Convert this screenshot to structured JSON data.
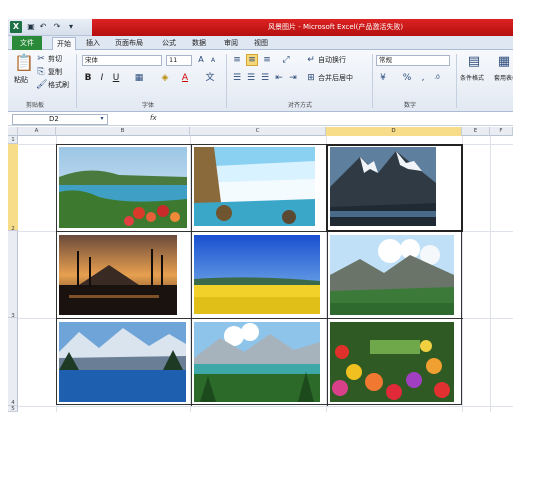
{
  "window": {
    "title": "风景图片 - Microsoft Excel(产品激活失败)"
  },
  "quick_access": {
    "app_icon": "excel-logo",
    "save_icon": "save-icon",
    "undo_icon": "undo-icon",
    "redo_icon": "redo-icon"
  },
  "ribbon_tabs": [
    "文件",
    "开始",
    "插入",
    "页面布局",
    "公式",
    "数据",
    "审阅",
    "视图"
  ],
  "ribbon": {
    "clipboard": {
      "paste": "粘贴",
      "cut": "剪切",
      "copy": "复制",
      "format_painter": "格式刷",
      "group_label": "剪贴板"
    },
    "font": {
      "font_name": "宋体",
      "font_size": "11",
      "bold": "B",
      "italic": "I",
      "underline": "U",
      "group_label": "字体"
    },
    "alignment": {
      "wrap_text": "自动换行",
      "merge_center": "合并后居中",
      "group_label": "对齐方式"
    },
    "number": {
      "format": "常规",
      "percent": "%",
      "comma": ",",
      "group_label": "数字"
    },
    "styles": {
      "conditional_format": "条件格式",
      "table_format": "套用表格格式"
    }
  },
  "formula_bar": {
    "name_box": "D2",
    "fx_label": "fx",
    "content": ""
  },
  "columns": [
    "A",
    "B",
    "C",
    "D",
    "E",
    "F"
  ],
  "selected_column": "D",
  "rows": [
    "1",
    "2",
    "3",
    "4",
    "5"
  ],
  "selected_row": "2",
  "photos": [
    {
      "name": "coastal-lake-with-flowers"
    },
    {
      "name": "waterfall"
    },
    {
      "name": "snowy-mountain-peak"
    },
    {
      "name": "sunset-trees-mountain"
    },
    {
      "name": "blue-sky-yellow-field"
    },
    {
      "name": "mountains-green-valley"
    },
    {
      "name": "blue-lake-snowy-mountains"
    },
    {
      "name": "mountain-lake-forest"
    },
    {
      "name": "colorful-flower-garden"
    }
  ],
  "colors": {
    "title_bar": "#c51a1a",
    "file_tab": "#2a8a3a",
    "selected_header": "#f7dc8a"
  }
}
